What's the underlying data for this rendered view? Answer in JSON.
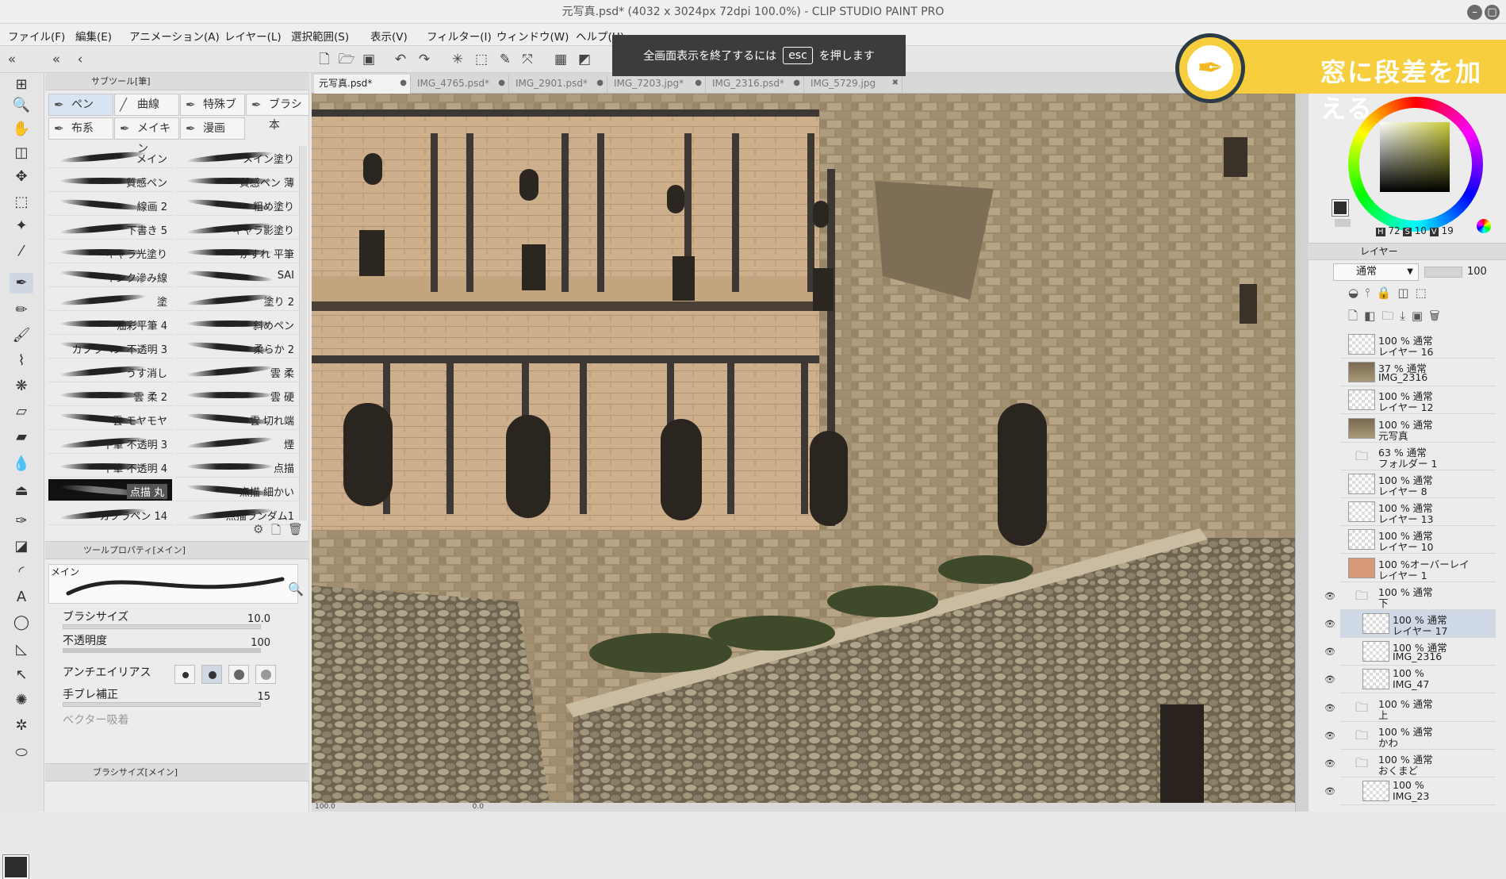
{
  "window": {
    "title": "元写真.psd* (4032 x 3024px 72dpi 100.0%)  - CLIP STUDIO PAINT PRO"
  },
  "menu": [
    "ファイル(F)",
    "編集(E)",
    "アニメーション(A)",
    "レイヤー(L)",
    "選択範囲(S)",
    "表示(V)",
    "フィルター(I)",
    "ウィンドウ(W)",
    "ヘルプ(H)"
  ],
  "esc_banner": {
    "before": "全画面表示を終了するには",
    "key": "esc",
    "after": "を押します"
  },
  "promo_banner": {
    "text": "窓に段差を加える",
    "icon": "pen-nib-icon"
  },
  "subtool": {
    "header": "サブツール[筆]",
    "groups": [
      "ペン",
      "曲線",
      "特殊ブ",
      "ブラシ本",
      "布系",
      "メイキン",
      "漫画"
    ],
    "brushes_left": [
      "メイン",
      "質感ペン",
      "線画 2",
      "下書き 5",
      "キャラ光塗り",
      "インク滲み線",
      "塗",
      "油彩平筆 4",
      "カブラペン 不透明 3",
      "うす消し",
      "雲 柔 2",
      "雲 モヤモヤ",
      "平筆 不透明 3",
      "平筆 不透明 4",
      "点描 丸",
      "カブラペン 14"
    ],
    "brushes_right": [
      "メイン塗り",
      "質感ペン 薄",
      "粗め塗り",
      "キャラ影塗り",
      "かすれ 平筆",
      "SAI",
      "塗り 2",
      "斜めペン",
      "柔らか 2",
      "雲 柔",
      "雲 硬",
      "雲 切れ端",
      "煙",
      "点描",
      "点描 細かい",
      "点描ランダム1"
    ],
    "active_brush": "点描 丸"
  },
  "tool_property": {
    "header": "ツールプロパティ[メイン]",
    "preview_label": "メイン",
    "brush_size_label": "ブラシサイズ",
    "brush_size_value": "10.0",
    "opacity_label": "不透明度",
    "opacity_value": "100",
    "antialias_label": "アンチエイリアス",
    "stabilization_label": "手ブレ補正",
    "stabilization_value": "15",
    "vector_snap_label": "ベクター吸着"
  },
  "brush_size_panel": {
    "header": "ブラシサイズ[メイン]"
  },
  "doc_tabs": [
    {
      "label": "元写真.psd*",
      "active": true
    },
    {
      "label": "IMG_4765.psd*",
      "active": false
    },
    {
      "label": "IMG_2901.psd*",
      "active": false
    },
    {
      "label": "IMG_7203.jpg*",
      "active": false
    },
    {
      "label": "IMG_2316.psd*",
      "active": false
    },
    {
      "label": "IMG_5729.jpg",
      "active": false
    }
  ],
  "canvas_status": {
    "zoom": "100.0",
    "angle": "0.0"
  },
  "color": {
    "h": "72",
    "s": "10",
    "v": "19",
    "h_label": "H",
    "s_label": "S",
    "v_label": "V"
  },
  "layer_panel": {
    "header": "レイヤー",
    "blend_mode": "通常",
    "opacity": "100",
    "layers": [
      {
        "line1": "100 % 通常",
        "line2": "レイヤー 16",
        "thumb": "empty",
        "selected": false,
        "visible": false
      },
      {
        "line1": "37 % 通常",
        "line2": "IMG_2316",
        "thumb": "photo",
        "selected": false,
        "visible": false
      },
      {
        "line1": "100 % 通常",
        "line2": "レイヤー 12",
        "thumb": "empty",
        "selected": false,
        "visible": false
      },
      {
        "line1": "100 % 通常",
        "line2": "元写真",
        "thumb": "photo",
        "selected": false,
        "visible": false
      },
      {
        "line1": "63 % 通常",
        "line2": "フォルダー 1",
        "thumb": "folder",
        "selected": false,
        "visible": false
      },
      {
        "line1": "100 % 通常",
        "line2": "レイヤー 8",
        "thumb": "empty",
        "selected": false,
        "visible": false
      },
      {
        "line1": "100 % 通常",
        "line2": "レイヤー 13",
        "thumb": "empty",
        "selected": false,
        "visible": false
      },
      {
        "line1": "100 % 通常",
        "line2": "レイヤー 10",
        "thumb": "empty",
        "selected": false,
        "visible": false
      },
      {
        "line1": "100 %オーバーレイ",
        "line2": "レイヤー 1",
        "thumb": "orange",
        "selected": false,
        "visible": false
      },
      {
        "line1": "100 % 通常",
        "line2": "下",
        "thumb": "folder",
        "selected": false,
        "visible": true
      },
      {
        "line1": "100 % 通常",
        "line2": "レイヤー 17",
        "thumb": "empty",
        "selected": true,
        "visible": true
      },
      {
        "line1": "100 % 通常",
        "line2": "IMG_2316",
        "thumb": "empty",
        "selected": false,
        "visible": true
      },
      {
        "line1": "100 %",
        "line2": "IMG_47",
        "thumb": "empty",
        "selected": false,
        "visible": true
      },
      {
        "line1": "100 % 通常",
        "line2": "上",
        "thumb": "folder",
        "selected": false,
        "visible": true
      },
      {
        "line1": "100 % 通常",
        "line2": "かわ",
        "thumb": "folder",
        "selected": false,
        "visible": true
      },
      {
        "line1": "100 % 通常",
        "line2": "おくまど",
        "thumb": "folder",
        "selected": false,
        "visible": true
      },
      {
        "line1": "100 %",
        "line2": "IMG_23",
        "thumb": "empty",
        "selected": false,
        "visible": true
      }
    ]
  }
}
